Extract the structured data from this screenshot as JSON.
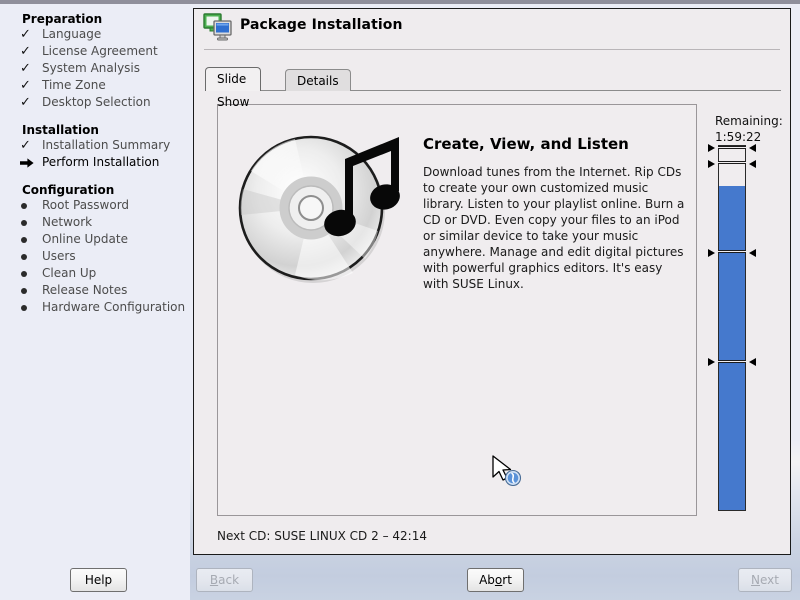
{
  "window": {
    "title": "Package Installation",
    "icon": "package-installation-icon"
  },
  "sidebar": {
    "sections": [
      {
        "heading": "Preparation",
        "items": [
          {
            "label": "Language",
            "state": "done",
            "marker": "check-icon"
          },
          {
            "label": "License Agreement",
            "state": "done",
            "marker": "check-icon"
          },
          {
            "label": "System Analysis",
            "state": "done",
            "marker": "check-icon"
          },
          {
            "label": "Time Zone",
            "state": "done",
            "marker": "check-icon"
          },
          {
            "label": "Desktop Selection",
            "state": "done",
            "marker": "check-icon"
          }
        ]
      },
      {
        "heading": "Installation",
        "items": [
          {
            "label": "Installation Summary",
            "state": "done",
            "marker": "check-icon"
          },
          {
            "label": "Perform Installation",
            "state": "current",
            "marker": "arrow-right-icon"
          }
        ]
      },
      {
        "heading": "Configuration",
        "items": [
          {
            "label": "Root Password",
            "state": "todo",
            "marker": "bullet-icon"
          },
          {
            "label": "Network",
            "state": "todo",
            "marker": "bullet-icon"
          },
          {
            "label": "Online Update",
            "state": "todo",
            "marker": "bullet-icon"
          },
          {
            "label": "Users",
            "state": "todo",
            "marker": "bullet-icon"
          },
          {
            "label": "Clean Up",
            "state": "todo",
            "marker": "bullet-icon"
          },
          {
            "label": "Release Notes",
            "state": "todo",
            "marker": "bullet-icon"
          },
          {
            "label": "Hardware Configuration",
            "state": "todo",
            "marker": "bullet-icon"
          }
        ]
      }
    ]
  },
  "tabs": [
    {
      "label": "Slide Show",
      "active": true
    },
    {
      "label": "Details",
      "active": false
    }
  ],
  "slide": {
    "image": "cd-with-music-notes-illustration",
    "title": "Create, View, and Listen",
    "body": "Download tunes from the Internet. Rip CDs to create your own customized music library. Listen to your playlist online. Burn a CD or DVD. Even copy your files to an iPod or similar device to take your music anywhere. Manage and edit digital pictures with powerful graphics editors. It's easy with SUSE Linux."
  },
  "status": {
    "next_cd": "Next CD: SUSE LINUX CD 2 – 42:14"
  },
  "progress": {
    "label": "Remaining:",
    "remaining_time": "1:59:22",
    "percent_complete": 89,
    "fill_color": "#4579cd",
    "cd_markers_percent": [
      40.5,
      70.5,
      95.0,
      99.2
    ]
  },
  "buttons": {
    "help": {
      "label": "Help",
      "enabled": true,
      "accel": ""
    },
    "back": {
      "label": "Back",
      "enabled": false,
      "accel": "B"
    },
    "abort": {
      "label": "Abort",
      "enabled": true,
      "accel": "o"
    },
    "next": {
      "label": "Next",
      "enabled": false,
      "accel": "N"
    }
  },
  "cursor": {
    "type": "arrow-busy-cursor"
  }
}
